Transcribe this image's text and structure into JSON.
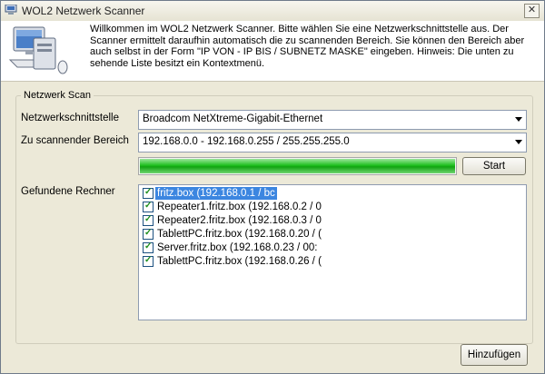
{
  "window": {
    "title": "WOL2 Netzwerk Scanner",
    "close_symbol": "✕"
  },
  "intro_text": "Willkommen im WOL2 Netzwerk Scanner. Bitte wählen Sie eine Netzwerkschnittstelle aus. Der Scanner ermittelt daraufhin automatisch die zu scannenden Bereich. Sie können den Bereich aber auch selbst in der Form \"IP VON - IP BIS / SUBNETZ MASKE\" eingeben. Hinweis: Die unten zu sehende Liste besitzt ein Kontextmenü.",
  "group_title": "Netzwerk Scan",
  "interface": {
    "label": "Netzwerkschnittstelle",
    "value": "Broadcom NetXtreme-Gigabit-Ethernet"
  },
  "range": {
    "label": "Zu scannender Bereich",
    "value": "192.168.0.0 - 192.168.0.255 / 255.255.255.0"
  },
  "progress_percent": 100,
  "progress_color": "#1fbf1f",
  "start_button": "Start",
  "found_label": "Gefundene Rechner",
  "hosts": [
    {
      "text": "fritz.box (192.168.0.1 / bc",
      "checked": true,
      "selected": true
    },
    {
      "text": "Repeater1.fritz.box (192.168.0.2 / 0",
      "checked": true,
      "selected": false
    },
    {
      "text": "Repeater2.fritz.box (192.168.0.3 / 0",
      "checked": true,
      "selected": false
    },
    {
      "text": "TablettPC.fritz.box (192.168.0.20 / (",
      "checked": true,
      "selected": false
    },
    {
      "text": "Server.fritz.box (192.168.0.23 / 00:",
      "checked": true,
      "selected": false
    },
    {
      "text": "TablettPC.fritz.box (192.168.0.26 / (",
      "checked": true,
      "selected": false
    }
  ],
  "add_button": "Hinzufügen",
  "selection_color": "#3c86e0"
}
